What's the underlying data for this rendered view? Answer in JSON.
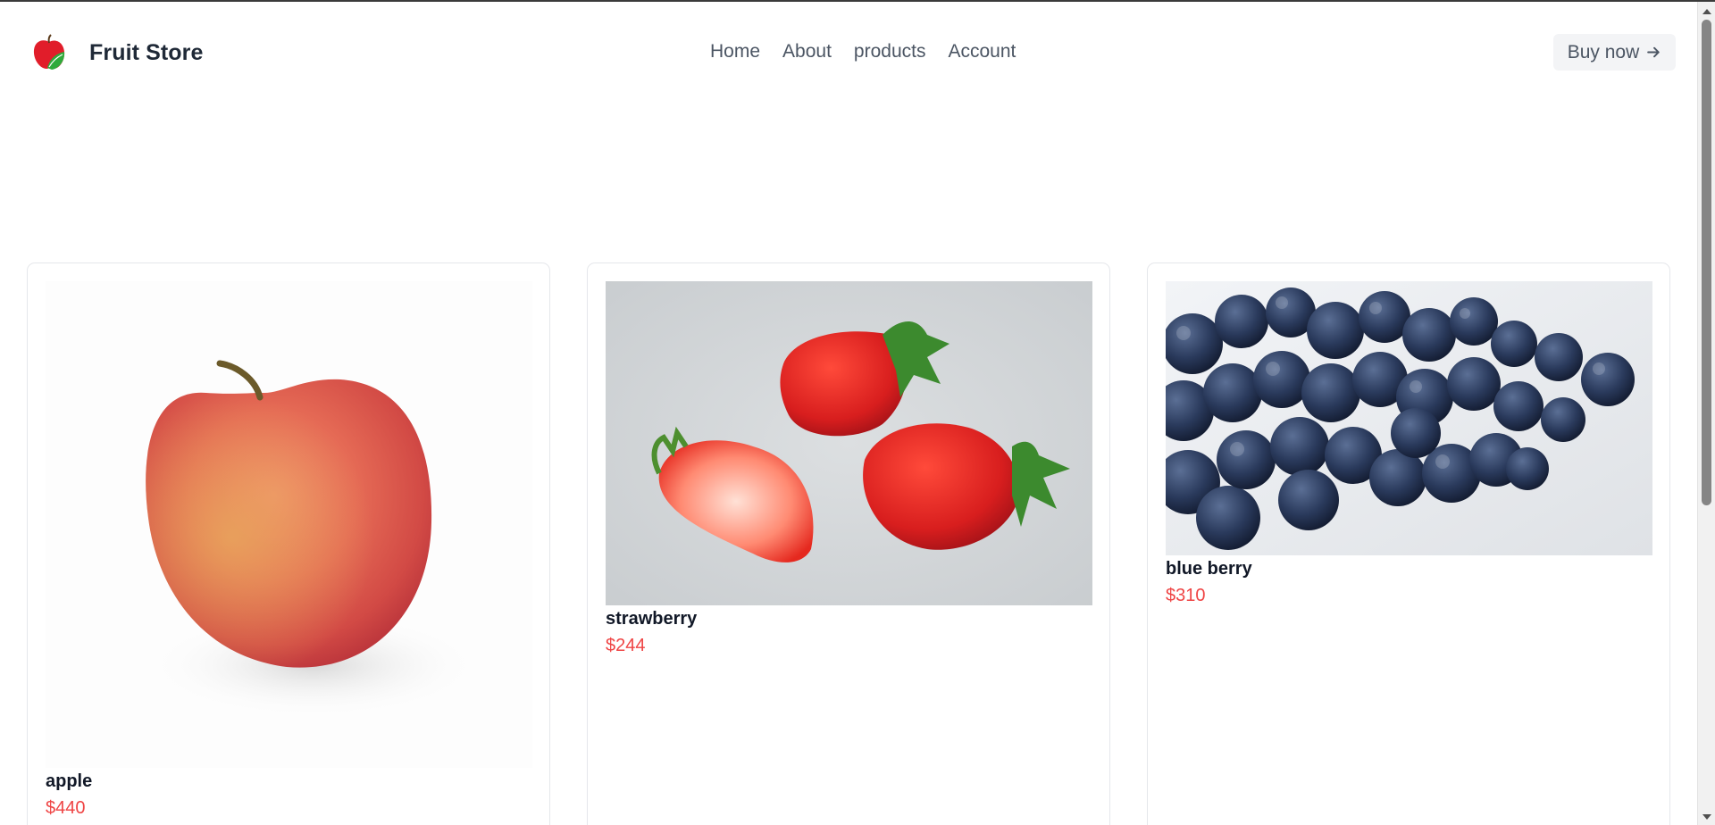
{
  "brand": {
    "name": "Fruit Store",
    "logo_icon": "apple-logo-icon"
  },
  "nav": {
    "items": [
      "Home",
      "About",
      "products",
      "Account"
    ]
  },
  "cta": {
    "label": "Buy now",
    "icon": "arrow-right-icon"
  },
  "products": [
    {
      "name": "apple",
      "price": "$440",
      "image": "apple-image"
    },
    {
      "name": "strawberry",
      "price": "$244",
      "image": "strawberry-image"
    },
    {
      "name": "blue berry",
      "price": "$310",
      "image": "blueberry-image"
    }
  ],
  "colors": {
    "price": "#ef4444",
    "button_bg": "#f3f4f6",
    "logo_red": "#e11d2a",
    "logo_green": "#2faa3b"
  }
}
